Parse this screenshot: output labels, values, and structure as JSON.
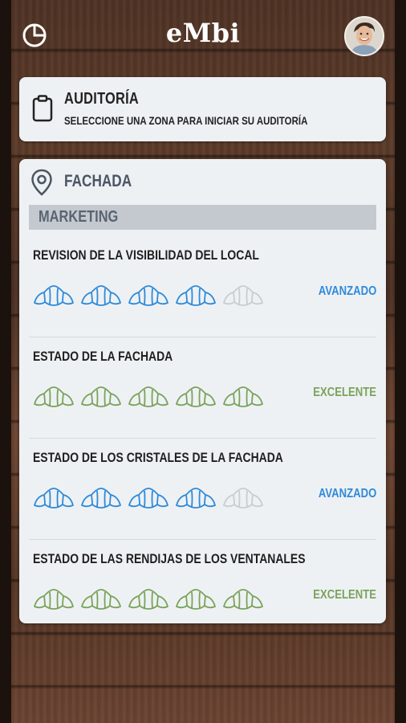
{
  "app": {
    "logo": "eMbi"
  },
  "audit": {
    "title": "AUDITORÍA",
    "subtitle": "SELECCIONE UNA ZONA PARA INICIAR SU AUDITORÍA"
  },
  "zone": {
    "name": "FACHADA",
    "section": "MARKETING",
    "items": [
      {
        "title": "REVISION DE LA VISIBILIDAD DEL LOCAL",
        "rating": 4,
        "max": 5,
        "level": "AVANZADO"
      },
      {
        "title": "ESTADO DE LA FACHADA",
        "rating": 5,
        "max": 5,
        "level": "EXCELENTE"
      },
      {
        "title": "ESTADO DE LOS CRISTALES DE LA FACHADA",
        "rating": 4,
        "max": 5,
        "level": "AVANZADO"
      },
      {
        "title": "ESTADO DE LAS RENDIJAS DE LOS VENTANALES",
        "rating": 5,
        "max": 5,
        "level": "EXCELENTE"
      }
    ]
  },
  "colors": {
    "avanzado": "#2f8ad9",
    "excelente": "#7aa35a",
    "empty": "#c9ccd0"
  },
  "icons": {
    "chart": "pie-chart-icon",
    "clipboard": "clipboard-icon",
    "pin": "location-pin-icon",
    "rating": "croissant-icon"
  }
}
